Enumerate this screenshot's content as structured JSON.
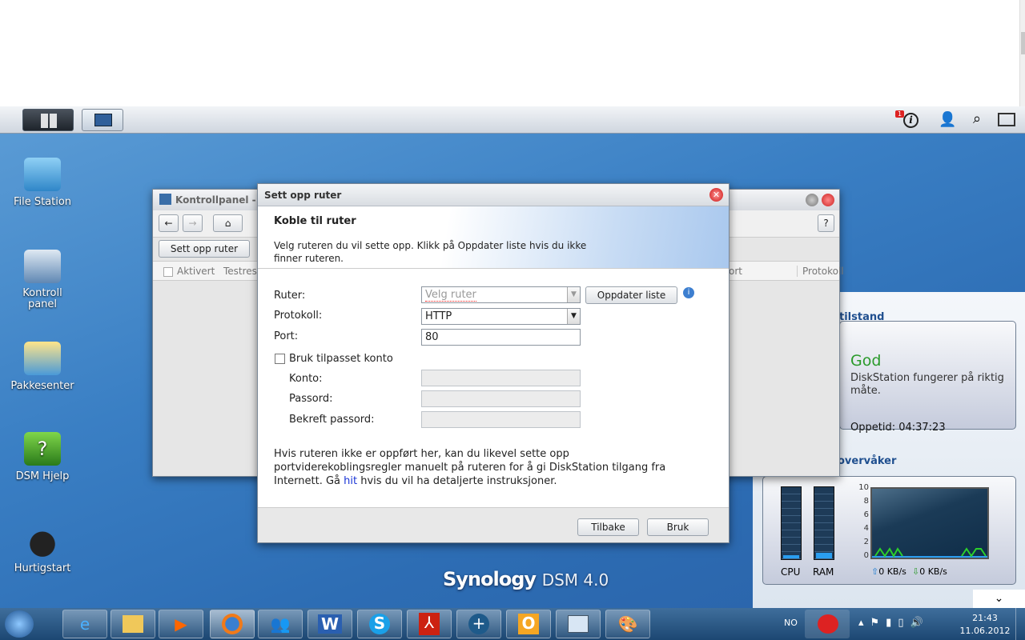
{
  "dsm_bar": {
    "notification_count": "1"
  },
  "desktop_icons": [
    {
      "label": "File Station"
    },
    {
      "label": "Kontroll panel"
    },
    {
      "label": "Pakkesenter"
    },
    {
      "label": "DSM Hjelp"
    },
    {
      "label": "Hurtigstart"
    }
  ],
  "control_panel": {
    "title": "Kontrollpanel - R",
    "setup_button": "Sett opp ruter",
    "columns": [
      "Aktivert",
      "Testres",
      "ort",
      "Protokoll"
    ]
  },
  "dialog": {
    "title": "Sett opp ruter",
    "header": "Koble til ruter",
    "description": "Velg ruteren du vil sette opp. Klikk på Oppdater liste hvis du ikke finner ruteren.",
    "router_label": "Ruter:",
    "router_placeholder": "Velg ruter",
    "refresh_button": "Oppdater liste",
    "protocol_label": "Protokoll:",
    "protocol_value": "HTTP",
    "port_label": "Port:",
    "port_value": "80",
    "custom_account_label": "Bruk tilpasset konto",
    "account_label": "Konto:",
    "password_label": "Passord:",
    "confirm_password_label": "Bekreft passord:",
    "footer_text_1": "Hvis ruteren ikke er oppført her, kan du likevel sette opp portviderekoblingsregler manuelt på ruteren for å gi DiskStation tilgang fra Internett. Gå ",
    "footer_link": "hit",
    "footer_text_2": " hvis du vil ha detaljerte instruksjoner.",
    "back_button": "Tilbake",
    "apply_button": "Bruk"
  },
  "widgets": {
    "health_title": "tilstand",
    "health_status": "God",
    "health_desc": "DiskStation fungerer på riktig måte.",
    "uptime": "Oppetid: 04:37:23",
    "monitor_title": "overvåker",
    "cpu_label": "CPU",
    "ram_label": "RAM",
    "cpu_percent": 5,
    "ram_percent": 8,
    "y_ticks": [
      "10",
      "8",
      "6",
      "4",
      "2",
      "0"
    ],
    "upload": "0 KB/s",
    "download": "0 KB/s"
  },
  "logo": {
    "brand": "Synology",
    "product": "DSM 4.0"
  },
  "taskbar": {
    "language": "NO",
    "time": "21:43",
    "date": "11.06.2012"
  },
  "colors": {
    "accent": "#1f4f8f",
    "good": "#2a9a2a",
    "link": "#1a35d6"
  }
}
